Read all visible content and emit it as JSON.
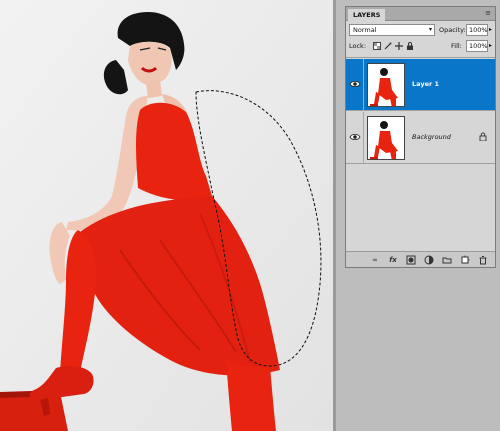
{
  "canvas": {
    "description_colors": {
      "background": "#ececec",
      "dress": "#e8230f"
    }
  },
  "layers_panel": {
    "tab_label": "LAYERS",
    "menu_icon": "panel-menu-icon",
    "blend_mode": "Normal",
    "opacity_label": "Opacity:",
    "opacity_value": "100%",
    "lock_label": "Lock:",
    "fill_label": "Fill:",
    "fill_value": "100%",
    "layers": [
      {
        "name": "Layer 1",
        "selected": true,
        "visible": true
      },
      {
        "name": "Background",
        "selected": false,
        "visible": true,
        "locked": true
      }
    ],
    "bottom_icons": [
      "link-layers-icon",
      "fx-icon",
      "layer-mask-icon",
      "adjustment-layer-icon",
      "group-folder-icon",
      "new-layer-icon",
      "trash-icon"
    ],
    "selection_color": "#0a76c9"
  }
}
